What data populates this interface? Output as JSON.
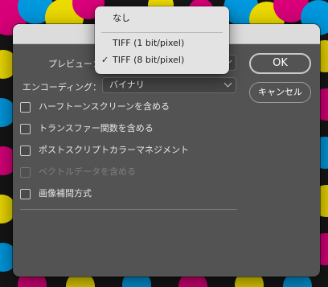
{
  "dialog": {
    "preview_label": "プレビュー：",
    "encoding_label": "エンコーディング：",
    "encoding_value": "バイナリ",
    "ok_label": "OK",
    "cancel_label": "キャンセル"
  },
  "options": [
    {
      "label": "ハーフトーンスクリーンを含める",
      "checked": false,
      "enabled": true
    },
    {
      "label": "トランスファー関数を含める",
      "checked": false,
      "enabled": true
    },
    {
      "label": "ポストスクリプトカラーマネジメント",
      "checked": false,
      "enabled": true
    },
    {
      "label": "ベクトルデータを含める",
      "checked": false,
      "enabled": false
    },
    {
      "label": "画像補間方式",
      "checked": false,
      "enabled": true
    }
  ],
  "preview_menu": {
    "items": [
      {
        "label": "なし",
        "selected": false
      },
      {
        "label": "TIFF (1 bit/pixel)",
        "selected": false
      },
      {
        "label": "TIFF (8 bit/pixel)",
        "selected": true
      }
    ],
    "checkmark": "✓"
  }
}
